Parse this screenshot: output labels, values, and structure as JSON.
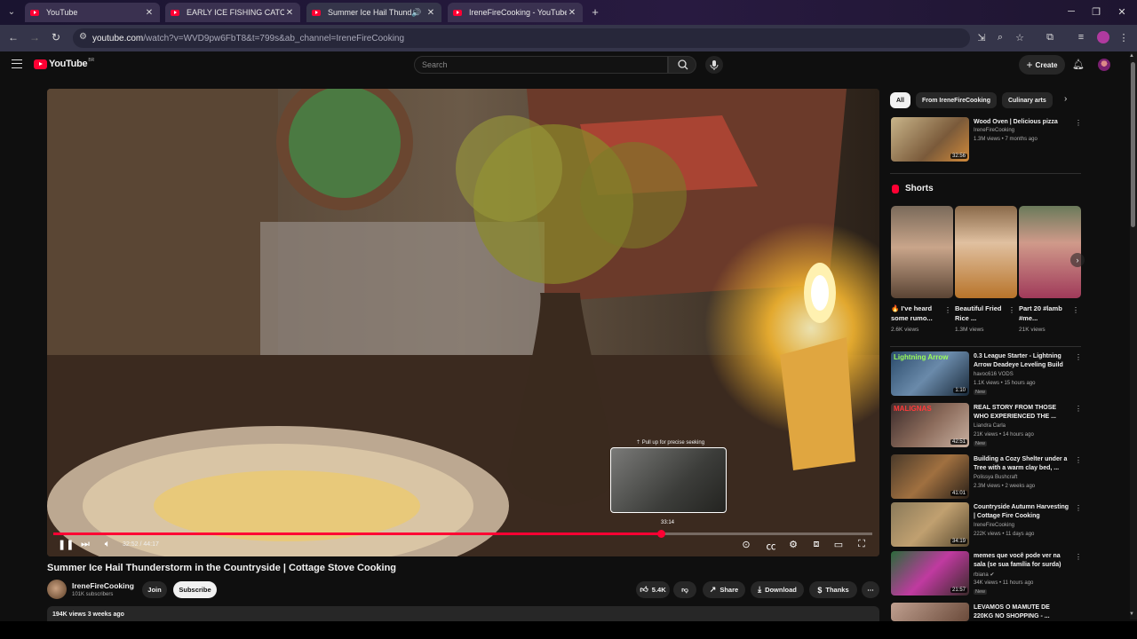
{
  "browser": {
    "tabs": [
      {
        "label": "YouTube"
      },
      {
        "label": "EARLY ICE FISHING CATCH AND"
      },
      {
        "label": "Summer Ice Hail Thunderstorm"
      },
      {
        "label": "IreneFireCooking - YouTube"
      }
    ],
    "url_domain": "youtube.com",
    "url_rest": "/watch?v=WVD9pw6FbT8&t=799s&ab_channel=IreneFireCooking"
  },
  "header": {
    "logo_text": "YouTube",
    "logo_country": "BR",
    "search_placeholder": "Search",
    "create_label": "Create"
  },
  "player": {
    "seek_hint": "⇡ Pull up for precise seeking",
    "preview_time": "33:14",
    "current_time": "32:52",
    "duration": "44:17",
    "time_display": "32:52 / 44:17",
    "progress_fraction": 0.742
  },
  "video": {
    "title": "Summer Ice Hail Thunderstorm in the Countryside | Cottage Stove Cooking",
    "channel": "IreneFireCooking",
    "subscribers": "101K subscribers",
    "join_label": "Join",
    "subscribe_label": "Subscribe",
    "likes": "5.4K",
    "share_label": "Share",
    "download_label": "Download",
    "thanks_label": "Thanks",
    "views_age": "194K views  3 weeks ago"
  },
  "sidebar": {
    "chips": [
      "All",
      "From IreneFireCooking",
      "Culinary arts"
    ],
    "top_rec": {
      "title": "Wood Oven | Delicious pizza",
      "channel": "IreneFireCooking",
      "meta": "1.3M views • 7 months ago",
      "duration": "32:56"
    },
    "shorts_heading": "Shorts",
    "shorts": [
      {
        "title": "🔥 I've heard some rumo...",
        "views": "2.6K views"
      },
      {
        "title": "Beautiful Fried Rice ...",
        "views": "1.3M views"
      },
      {
        "title": "Part 20 #lamb #me...",
        "views": "21K views"
      }
    ],
    "recs": [
      {
        "title": "0.3 League Starter - Lightning Arrow Deadeye Leveling Build ...",
        "channel": "havoc616 VODS",
        "meta": "1.1K views • 15 hours ago",
        "badge": "New",
        "duration": "1:10",
        "thumb_text": "Lightning Arrow"
      },
      {
        "title": "REAL STORY FROM THOSE WHO EXPERIENCED THE ...",
        "channel": "Liandra Carla",
        "meta": "21K views • 14 hours ago",
        "badge": "New",
        "duration": "42:51",
        "thumb_text": "MALIGNAS"
      },
      {
        "title": "Building a Cozy Shelter under a Tree with a warm clay bed, ...",
        "channel": "Polissya Bushcraft",
        "meta": "2.3M views • 2 weeks ago",
        "badge": "",
        "duration": "41:01",
        "thumb_text": ""
      },
      {
        "title": "Countryside Autumn Harvesting | Cottage Fire Cooking",
        "channel": "IreneFireCooking",
        "meta": "222K views • 11 days ago",
        "badge": "",
        "duration": "34:19",
        "thumb_text": ""
      },
      {
        "title": "memes que você pode ver na sala (se sua família for surda)",
        "channel": "rbiana ✔",
        "meta": "34K views • 11 hours ago",
        "badge": "New",
        "duration": "21:57",
        "thumb_text": ""
      },
      {
        "title": "LEVAMOS O MAMUTE DE 220KG NO SHOPPING - ...",
        "channel": "",
        "meta": "",
        "badge": "",
        "duration": "",
        "thumb_text": ""
      }
    ]
  },
  "colors": {
    "brand_red": "#ff0033",
    "bg": "#0f0f0f",
    "surface": "#272727"
  }
}
